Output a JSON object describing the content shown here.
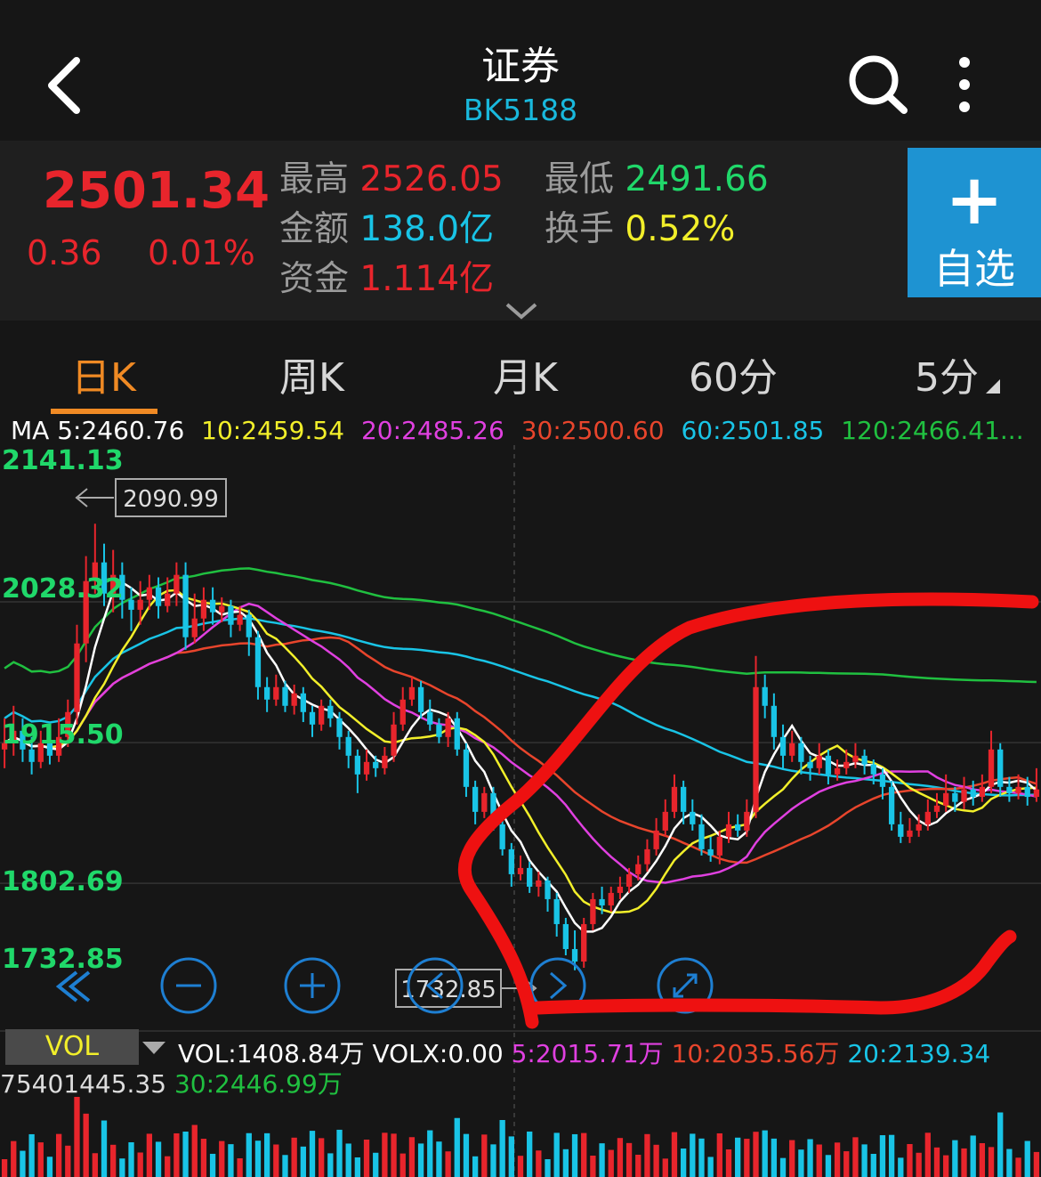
{
  "header": {
    "title": "证券",
    "code": "BK5188"
  },
  "quote": {
    "price": "2501.34",
    "change": "0.36",
    "change_pct": "0.01%",
    "high_label": "最高",
    "high": "2526.05",
    "low_label": "最低",
    "low": "2491.66",
    "amount_label": "金额",
    "amount": "138.0亿",
    "turnover_label": "换手",
    "turnover": "0.52%",
    "fund_label": "资金",
    "fund": "1.114亿",
    "add_plus": "+",
    "add_label": "自选"
  },
  "tabs": [
    {
      "label": "日K"
    },
    {
      "label": "周K"
    },
    {
      "label": "月K"
    },
    {
      "label": "60分"
    },
    {
      "label": "5分"
    }
  ],
  "ma": {
    "label": "MA",
    "ma5": "5:2460.76",
    "ma10": "10:2459.54",
    "ma20": "20:2485.26",
    "ma30": "30:2500.60",
    "ma60": "60:2501.85",
    "ma120": "120:2466.41..."
  },
  "y_labels": {
    "top": "2141.13",
    "l2": "2028.32",
    "l3": "1915.50",
    "l4": "1802.69",
    "bottom": "1732.85"
  },
  "annotations": {
    "max_marker": "2090.99",
    "min_marker": "1732.85"
  },
  "vol": {
    "tag": "VOL",
    "vol": "VOL:1408.84万",
    "volx": "VOLX:0.00",
    "v5": "5:2015.71万",
    "v10": "10:2035.56万",
    "v20": "20:2139.34",
    "max": "75401445.35",
    "v30": "30:2446.99万"
  },
  "colors": {
    "up": "#e8252c",
    "down": "#19c4e6",
    "ma5": "#ffffff",
    "ma10": "#f2ef2a",
    "ma20": "#e040e0",
    "ma30": "#e8452c",
    "ma60": "#19c4e6",
    "ma120": "#20c040",
    "accent": "#f08a24",
    "brand": "#1e93d2"
  },
  "chart_data": {
    "type": "candlestick",
    "y_axis_ticks": [
      2141.13,
      2028.32,
      1915.5,
      1802.69,
      1732.85
    ],
    "ylim": [
      1732.85,
      2141.13
    ],
    "highest_marker": 2090.99,
    "lowest_marker": 1732.85,
    "candles": [
      [
        1910,
        1915,
        1935,
        1895
      ],
      [
        1915,
        1925,
        1945,
        1905
      ],
      [
        1925,
        1910,
        1935,
        1900
      ],
      [
        1910,
        1900,
        1920,
        1890
      ],
      [
        1900,
        1915,
        1925,
        1895
      ],
      [
        1915,
        1905,
        1925,
        1898
      ],
      [
        1905,
        1920,
        1935,
        1900
      ],
      [
        1920,
        1940,
        1950,
        1912
      ],
      [
        1940,
        1995,
        2010,
        1930
      ],
      [
        1995,
        2045,
        2065,
        1980
      ],
      [
        2045,
        2060,
        2091,
        2035
      ],
      [
        2060,
        2035,
        2075,
        2025
      ],
      [
        2035,
        2050,
        2070,
        2020
      ],
      [
        2050,
        2030,
        2060,
        2015
      ],
      [
        2030,
        2022,
        2040,
        2005
      ],
      [
        2022,
        2030,
        2045,
        2010
      ],
      [
        2030,
        2040,
        2050,
        2022
      ],
      [
        2040,
        2025,
        2048,
        2015
      ],
      [
        2025,
        2035,
        2048,
        2020
      ],
      [
        2035,
        2050,
        2060,
        2025
      ],
      [
        2050,
        2000,
        2060,
        1990
      ],
      [
        2000,
        2015,
        2035,
        1995
      ],
      [
        2015,
        2030,
        2040,
        2005
      ],
      [
        2030,
        2020,
        2040,
        2010
      ],
      [
        2020,
        2025,
        2032,
        2012
      ],
      [
        2025,
        2010,
        2030,
        2000
      ],
      [
        2010,
        2018,
        2025,
        2005
      ],
      [
        2018,
        2000,
        2022,
        1985
      ],
      [
        2000,
        1960,
        2005,
        1950
      ],
      [
        1960,
        1950,
        1968,
        1940
      ],
      [
        1950,
        1960,
        1970,
        1945
      ],
      [
        1960,
        1945,
        1965,
        1940
      ],
      [
        1945,
        1955,
        1962,
        1938
      ],
      [
        1955,
        1940,
        1960,
        1932
      ],
      [
        1940,
        1930,
        1945,
        1920
      ],
      [
        1930,
        1945,
        1950,
        1925
      ],
      [
        1945,
        1935,
        1950,
        1928
      ],
      [
        1935,
        1920,
        1940,
        1910
      ],
      [
        1920,
        1905,
        1925,
        1895
      ],
      [
        1905,
        1890,
        1910,
        1875
      ],
      [
        1890,
        1900,
        1910,
        1885
      ],
      [
        1900,
        1895,
        1905,
        1888
      ],
      [
        1895,
        1905,
        1912,
        1890
      ],
      [
        1905,
        1930,
        1940,
        1900
      ],
      [
        1930,
        1950,
        1960,
        1925
      ],
      [
        1950,
        1960,
        1968,
        1945
      ],
      [
        1960,
        1940,
        1965,
        1935
      ],
      [
        1940,
        1930,
        1950,
        1925
      ],
      [
        1930,
        1920,
        1935,
        1915
      ],
      [
        1920,
        1935,
        1940,
        1912
      ],
      [
        1935,
        1910,
        1940,
        1905
      ],
      [
        1910,
        1880,
        1915,
        1872
      ],
      [
        1880,
        1860,
        1885,
        1850
      ],
      [
        1860,
        1875,
        1880,
        1855
      ],
      [
        1875,
        1850,
        1880,
        1845
      ],
      [
        1850,
        1830,
        1855,
        1825
      ],
      [
        1830,
        1810,
        1835,
        1800
      ],
      [
        1810,
        1815,
        1825,
        1805
      ],
      [
        1815,
        1800,
        1820,
        1795
      ],
      [
        1800,
        1805,
        1812,
        1792
      ],
      [
        1805,
        1790,
        1808,
        1780
      ],
      [
        1790,
        1770,
        1795,
        1760
      ],
      [
        1770,
        1750,
        1775,
        1745
      ],
      [
        1750,
        1740,
        1765,
        1733
      ],
      [
        1740,
        1770,
        1775,
        1735
      ],
      [
        1770,
        1790,
        1795,
        1765
      ],
      [
        1790,
        1785,
        1800,
        1778
      ],
      [
        1785,
        1795,
        1800,
        1780
      ],
      [
        1795,
        1800,
        1808,
        1790
      ],
      [
        1800,
        1810,
        1815,
        1795
      ],
      [
        1810,
        1818,
        1825,
        1805
      ],
      [
        1818,
        1830,
        1838,
        1812
      ],
      [
        1830,
        1845,
        1855,
        1825
      ],
      [
        1845,
        1860,
        1870,
        1840
      ],
      [
        1860,
        1880,
        1890,
        1855
      ],
      [
        1880,
        1860,
        1885,
        1850
      ],
      [
        1860,
        1850,
        1870,
        1845
      ],
      [
        1850,
        1830,
        1858,
        1825
      ],
      [
        1830,
        1825,
        1840,
        1820
      ],
      [
        1825,
        1840,
        1845,
        1818
      ],
      [
        1840,
        1850,
        1860,
        1835
      ],
      [
        1850,
        1845,
        1858,
        1840
      ],
      [
        1845,
        1860,
        1870,
        1840
      ],
      [
        1860,
        1960,
        1985,
        1855
      ],
      [
        1960,
        1945,
        1970,
        1935
      ],
      [
        1945,
        1920,
        1955,
        1910
      ],
      [
        1920,
        1905,
        1930,
        1895
      ],
      [
        1905,
        1915,
        1925,
        1900
      ],
      [
        1915,
        1900,
        1920,
        1890
      ],
      [
        1900,
        1895,
        1905,
        1885
      ],
      [
        1895,
        1905,
        1915,
        1890
      ],
      [
        1905,
        1890,
        1910,
        1882
      ],
      [
        1890,
        1895,
        1902,
        1885
      ],
      [
        1895,
        1900,
        1910,
        1890
      ],
      [
        1900,
        1905,
        1915,
        1895
      ],
      [
        1905,
        1898,
        1910,
        1890
      ],
      [
        1898,
        1890,
        1902,
        1882
      ],
      [
        1890,
        1880,
        1895,
        1870
      ],
      [
        1880,
        1850,
        1885,
        1845
      ],
      [
        1850,
        1840,
        1860,
        1835
      ],
      [
        1840,
        1845,
        1855,
        1835
      ],
      [
        1845,
        1850,
        1858,
        1840
      ],
      [
        1850,
        1860,
        1870,
        1845
      ],
      [
        1860,
        1865,
        1875,
        1855
      ],
      [
        1865,
        1875,
        1890,
        1860
      ],
      [
        1875,
        1868,
        1880,
        1860
      ],
      [
        1868,
        1878,
        1888,
        1862
      ],
      [
        1878,
        1872,
        1885,
        1865
      ],
      [
        1872,
        1880,
        1890,
        1868
      ],
      [
        1880,
        1910,
        1925,
        1875
      ],
      [
        1910,
        1880,
        1915,
        1872
      ],
      [
        1880,
        1875,
        1888,
        1868
      ],
      [
        1875,
        1880,
        1890,
        1870
      ],
      [
        1880,
        1872,
        1888,
        1865
      ],
      [
        1872,
        1878,
        1895,
        1868
      ]
    ],
    "volume_max": 75401445.35
  }
}
